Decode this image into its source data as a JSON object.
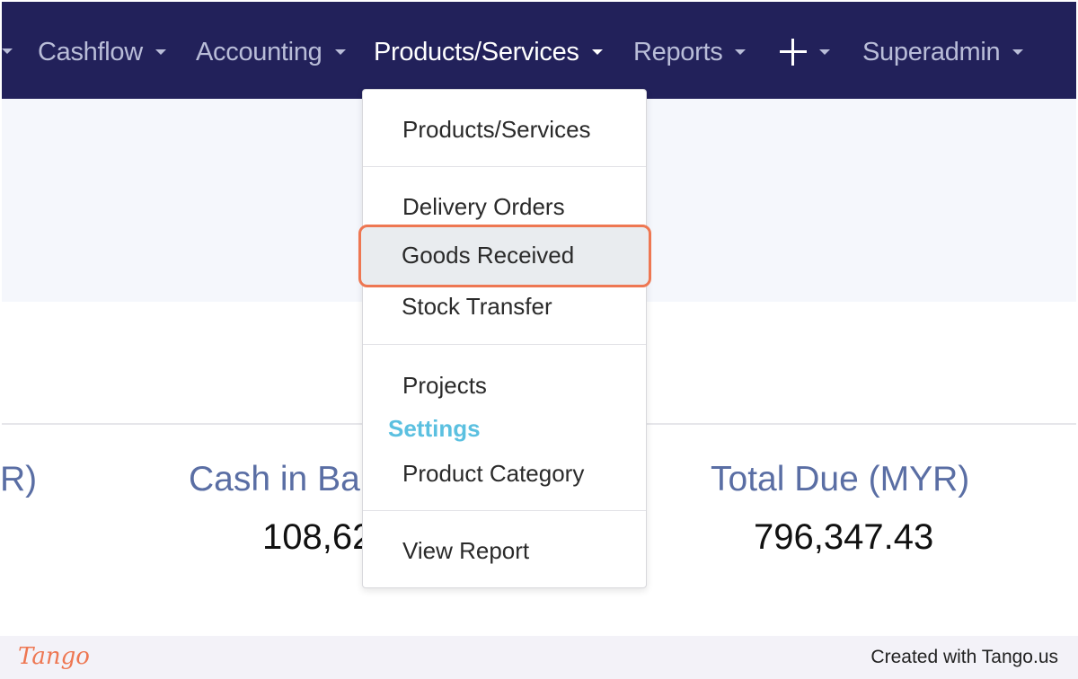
{
  "nav": {
    "items": [
      {
        "label": "Cashflow"
      },
      {
        "label": "Accounting"
      },
      {
        "label": "Products/Services"
      },
      {
        "label": "Reports"
      },
      {
        "label": "Superadmin"
      }
    ],
    "plus_icon": "plus-icon"
  },
  "stats": {
    "partial_label": "R)",
    "cash_label": "Cash in Ba",
    "cash_value": "108,62",
    "due_label": "Total Due (MYR)",
    "due_value": "796,347.43"
  },
  "dropdown": {
    "items": [
      {
        "label": "Products/Services"
      },
      {
        "label": "Delivery Orders"
      },
      {
        "label": "Goods Received"
      },
      {
        "label": "Stock Transfer"
      },
      {
        "label": "Projects"
      },
      {
        "label": "Product Category"
      },
      {
        "label": "View Report"
      }
    ],
    "settings_header": "Settings",
    "highlighted_item": "Goods Received"
  },
  "footer": {
    "logo": "Tango",
    "credit": "Created with Tango.us"
  },
  "colors": {
    "navbar": "#22215a",
    "highlight_border": "#ee7752",
    "settings_header": "#5bc0e0",
    "stat_label": "#5a6ea4"
  }
}
